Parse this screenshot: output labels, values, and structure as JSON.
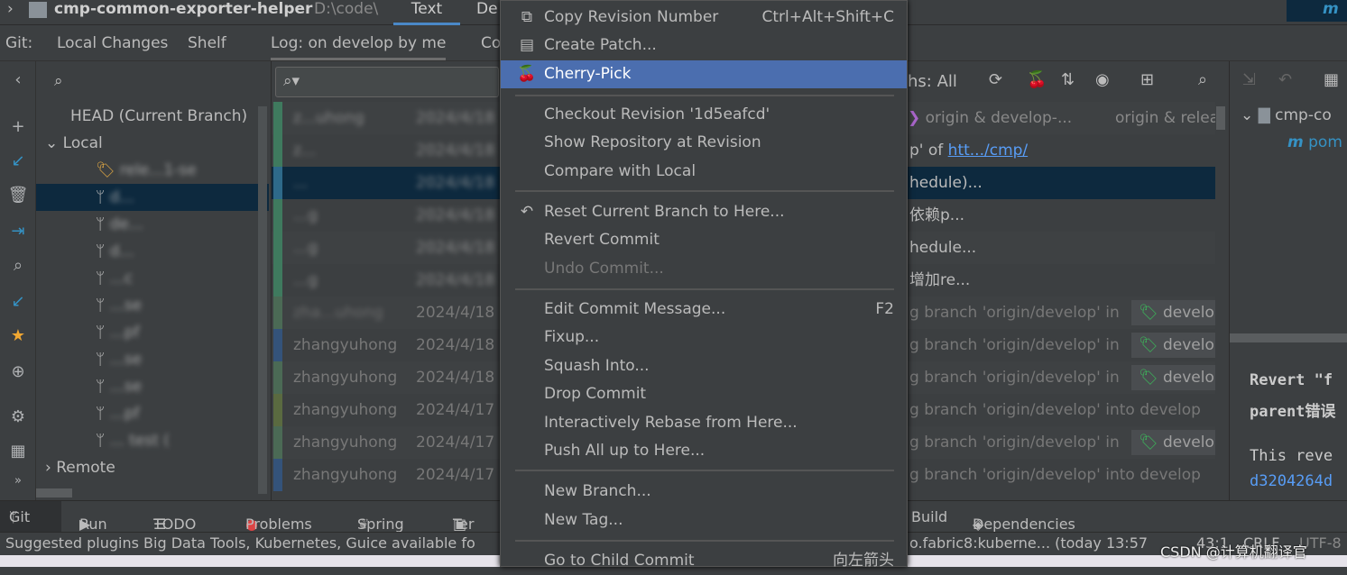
{
  "title": {
    "project": "cmp-common-exporter-helper",
    "path": "D:\\code\\",
    "editor_tabs": [
      "Text",
      "De"
    ],
    "right_tab": "m"
  },
  "git_tabs": {
    "prefix": "Git:",
    "items": [
      "Local Changes",
      "Shelf",
      "Log: on develop by me",
      "Co"
    ]
  },
  "branches": {
    "head": "HEAD (Current Branch)",
    "local": "Local",
    "items": [
      "rele...1-se",
      "d...",
      "de...",
      "d...",
      "...c",
      "...se",
      "...pf",
      "...se",
      "...se",
      "...pf",
      "... test ("
    ],
    "remote": "Remote"
  },
  "log": {
    "rows": [
      {
        "author": "z...uhong",
        "date": "2024/4/18"
      },
      {
        "author": "z...",
        "date": "2024/4/18"
      },
      {
        "author": "...",
        "date": "2024/4/18"
      },
      {
        "author": "...g",
        "date": "2024/4/18"
      },
      {
        "author": "...g",
        "date": "2024/4/18"
      },
      {
        "author": "...g",
        "date": "2024/4/18"
      },
      {
        "author": "zha...uhong",
        "date": "2024/4/18"
      },
      {
        "author": "zhangyuhong",
        "date": "2024/4/18"
      },
      {
        "author": "zhangyuhong",
        "date": "2024/4/18"
      },
      {
        "author": "zhangyuhong",
        "date": "2024/4/17"
      },
      {
        "author": "zhangyuhong",
        "date": "2024/4/17"
      },
      {
        "author": "zhangyuhong",
        "date": "2024/4/17"
      }
    ],
    "messages": [
      {
        "text": "origin & develop-...",
        "tag": "origin & releas"
      },
      {
        "text": "p' of ",
        "link": "htt.../cmp/"
      },
      {
        "text": "hedule)..."
      },
      {
        "text": "依赖p..."
      },
      {
        "text": "hedule..."
      },
      {
        "text": "增加re..."
      },
      {
        "text": "g branch 'origin/develop' in",
        "tag": "develop"
      },
      {
        "text": "g branch 'origin/develop' in",
        "tag": "develop"
      },
      {
        "text": "g branch 'origin/develop' in",
        "tag": "develop"
      },
      {
        "text": "g branch 'origin/develop' into develop"
      },
      {
        "text": "g branch 'origin/develop' in",
        "tag": "develop"
      },
      {
        "text": "g branch 'origin/develop' into develop"
      }
    ],
    "branches_filter": "hs: All"
  },
  "menu": {
    "items": [
      {
        "label": "Copy Revision Number",
        "shortcut": "Ctrl+Alt+Shift+C",
        "icon": "copy-icon"
      },
      {
        "label": "Create Patch...",
        "icon": "patch-icon"
      },
      {
        "label": "Cherry-Pick",
        "icon": "cherry-icon",
        "selected": true
      },
      {
        "label": "Checkout Revision '1d5eafcd'"
      },
      {
        "label": "Show Repository at Revision"
      },
      {
        "label": "Compare with Local"
      },
      {
        "label": "Reset Current Branch to Here...",
        "icon": "reset-icon"
      },
      {
        "label": "Revert Commit"
      },
      {
        "label": "Undo Commit...",
        "disabled": true
      },
      {
        "label": "Edit Commit Message...",
        "shortcut": "F2"
      },
      {
        "label": "Fixup..."
      },
      {
        "label": "Squash Into..."
      },
      {
        "label": "Drop Commit"
      },
      {
        "label": "Interactively Rebase from Here..."
      },
      {
        "label": "Push All up to Here..."
      },
      {
        "label": "New Branch..."
      },
      {
        "label": "New Tag..."
      },
      {
        "label": "Go to Child Commit",
        "shortcut": "向左箭头"
      }
    ]
  },
  "details": {
    "tree_root": "cmp-co",
    "tree_file": "pom",
    "msg1": "Revert \"f",
    "msg2": "parent错误",
    "msg3": "This reve",
    "hash": "d3204264d"
  },
  "bottom_tabs": [
    "Git",
    "Run",
    "TODO",
    "Problems",
    "Spring",
    "Ter",
    "Build",
    "Dependencies"
  ],
  "status": {
    "left": "Suggested plugins Big Data Tools, Kubernetes, Guice available fo",
    "middle": "o.fabric8:kuberne... (today 13:57",
    "position": "43:1",
    "line_sep": "CRLF",
    "encoding": "UTF-8",
    "watermark": "CSDN @计算机翻译官"
  },
  "colors": {
    "selection": "#4b6eaf",
    "tree_selection": "#0d293e",
    "tag_green": "#3cb55a",
    "link": "#589df6"
  }
}
